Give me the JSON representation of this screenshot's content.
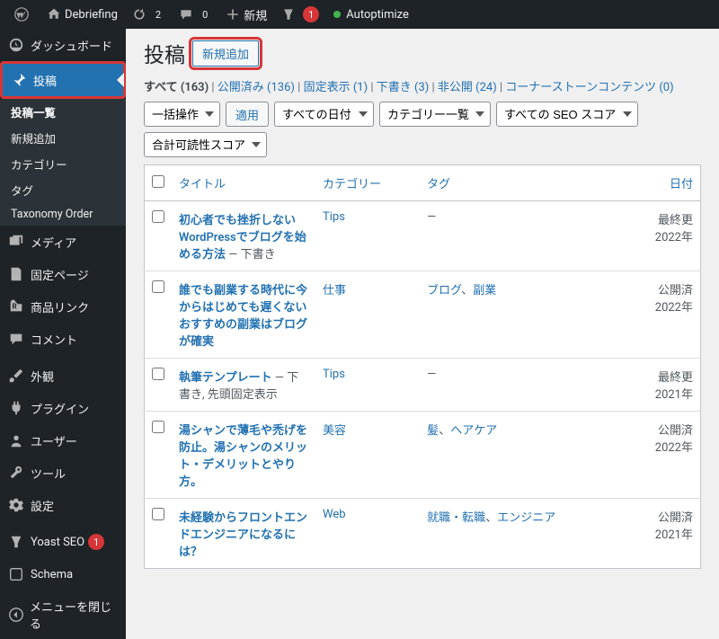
{
  "adminbar": {
    "site_name": "Debriefing",
    "updates": "2",
    "comments": "0",
    "new": "新規",
    "yoast_badge": "1",
    "autoptimize": "Autoptimize"
  },
  "sidebar": {
    "dashboard": "ダッシュボード",
    "posts": "投稿",
    "submenu": {
      "all": "投稿一覧",
      "new": "新規追加",
      "categories": "カテゴリー",
      "tags": "タグ",
      "taxonomy_order": "Taxonomy Order"
    },
    "media": "メディア",
    "pages": "固定ページ",
    "product_links": "商品リンク",
    "comments": "コメント",
    "appearance": "外観",
    "plugins": "プラグイン",
    "users": "ユーザー",
    "tools": "ツール",
    "settings": "設定",
    "yoast": "Yoast SEO",
    "yoast_badge": "1",
    "schema": "Schema",
    "collapse": "メニューを閉じる"
  },
  "page": {
    "title": "投稿",
    "add_new": "新規追加"
  },
  "filters": {
    "all": "すべて",
    "all_count": "(163)",
    "published": "公開済み",
    "published_count": "(136)",
    "sticky": "固定表示",
    "sticky_count": "(1)",
    "draft": "下書き",
    "draft_count": "(3)",
    "private": "非公開",
    "private_count": "(24)",
    "cornerstone": "コーナーストーンコンテンツ",
    "cornerstone_count": "(0)"
  },
  "controls": {
    "bulk": "一括操作",
    "apply": "適用",
    "date": "すべての日付",
    "category": "カテゴリー一覧",
    "seo": "すべての SEO スコア",
    "readability": "合計可読性スコア"
  },
  "columns": {
    "title": "タイトル",
    "category": "カテゴリー",
    "tags": "タグ",
    "date": "日付"
  },
  "rows": [
    {
      "title": "初心者でも挫折しないWordPressでブログを始める方法",
      "state": " — 下書き",
      "category": "Tips",
      "tags_display": "—",
      "tags": [],
      "date1": "最終更",
      "date2": "2022年"
    },
    {
      "title": "誰でも副業する時代に今からはじめても遅くないおすすめの副業はブログが確実",
      "state": "",
      "category": "仕事",
      "tags_display": "",
      "tags": [
        "ブログ",
        "副業"
      ],
      "date1": "公開済",
      "date2": "2022年"
    },
    {
      "title": "執筆テンプレート",
      "state": " — 下書き, 先頭固定表示",
      "category": "Tips",
      "tags_display": "—",
      "tags": [],
      "date1": "最終更",
      "date2": "2021年"
    },
    {
      "title": "湯シャンで薄毛や禿げを防止。湯シャンのメリット・デメリットとやり方。",
      "state": "",
      "category": "美容",
      "tags_display": "",
      "tags": [
        "髪",
        "ヘアケア"
      ],
      "date1": "公開済",
      "date2": "2022年"
    },
    {
      "title": "未経験からフロントエンドエンジニアになるには？",
      "state": "",
      "category": "Web",
      "tags_display": "",
      "tags": [
        "就職・転職",
        "エンジニア"
      ],
      "date1": "公開済",
      "date2": "2021年"
    }
  ]
}
